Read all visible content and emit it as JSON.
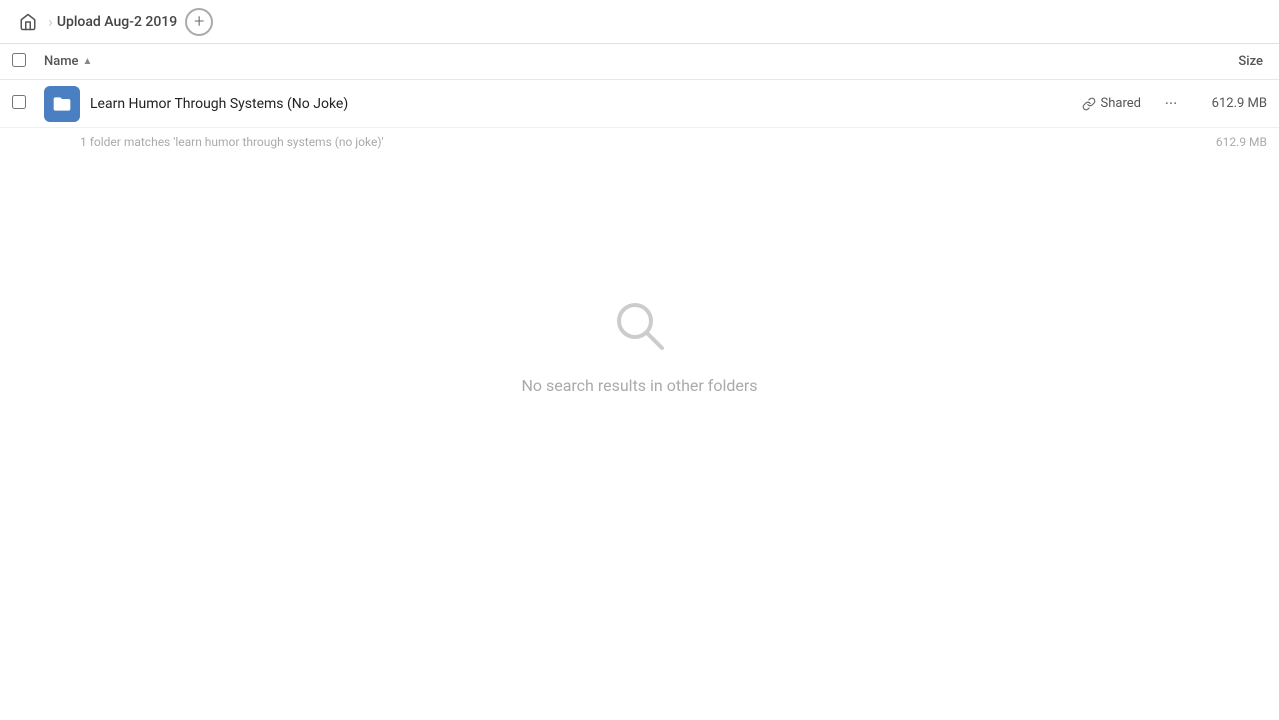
{
  "nav": {
    "home_icon": "home",
    "breadcrumb": {
      "label": "Upload Aug-2 2019"
    },
    "add_button_label": "+"
  },
  "headers": {
    "checkbox_label": "select-all",
    "name_label": "Name",
    "sort_arrow": "▲",
    "size_label": "Size"
  },
  "file_row": {
    "name": "Learn Humor Through Systems (No Joke)",
    "shared_label": "Shared",
    "size": "612.9 MB",
    "match_info": "1 folder matches 'learn humor through systems (no joke)'",
    "match_size": "612.9 MB"
  },
  "empty_state": {
    "message": "No search results in other folders"
  }
}
